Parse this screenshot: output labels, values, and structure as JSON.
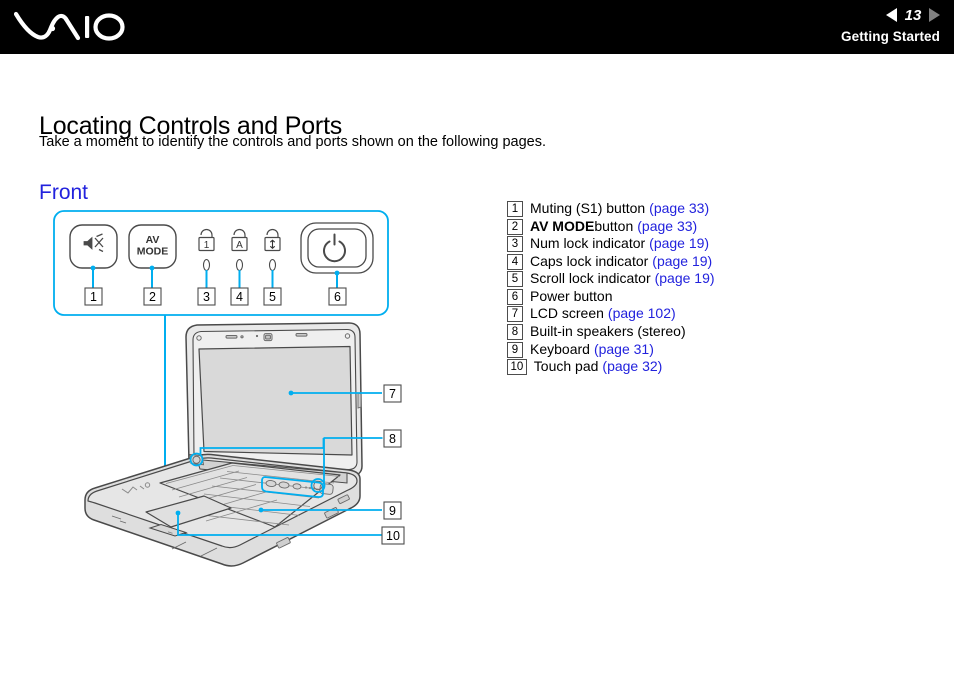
{
  "header": {
    "logo_text": "VAIO",
    "logo_icon": "vaio-logo",
    "prev_icon": "triangle-left-icon",
    "next_icon": "triangle-right-icon",
    "page_number": "13",
    "section": "Getting Started"
  },
  "content": {
    "title": "Locating Controls and Ports",
    "intro": "Take a moment to identify the controls and ports shown on the following pages.",
    "subsection": "Front"
  },
  "legend": {
    "items": [
      {
        "num": "1",
        "label": "Muting (S1) button",
        "bold": false,
        "ref": "(page 33)"
      },
      {
        "num": "2",
        "label": "AV MODE",
        "bold": true,
        "label_after": " button",
        "ref": "(page 33)"
      },
      {
        "num": "3",
        "label": "Num lock indicator",
        "bold": false,
        "ref": "(page 19)"
      },
      {
        "num": "4",
        "label": "Caps lock indicator",
        "bold": false,
        "ref": "(page 19)"
      },
      {
        "num": "5",
        "label": "Scroll lock indicator",
        "bold": false,
        "ref": "(page 19)"
      },
      {
        "num": "6",
        "label": "Power button",
        "bold": false,
        "ref": ""
      },
      {
        "num": "7",
        "label": "LCD screen",
        "bold": false,
        "ref": "(page 102)"
      },
      {
        "num": "8",
        "label": "Built-in speakers (stereo)",
        "bold": false,
        "ref": ""
      },
      {
        "num": "9",
        "label": "Keyboard",
        "bold": false,
        "ref": "(page 31)"
      },
      {
        "num": "10",
        "label": "Touch pad",
        "bold": false,
        "ref": "(page 32)"
      }
    ]
  },
  "diagram": {
    "panel_callouts": [
      "1",
      "2",
      "3",
      "4",
      "5",
      "6"
    ],
    "laptop_callouts": [
      "7",
      "8",
      "9",
      "10"
    ],
    "controls": [
      {
        "name": "mute-button",
        "icon": "speaker-mute-icon",
        "label": ""
      },
      {
        "name": "av-mode-button",
        "icon": "",
        "label_line1": "AV",
        "label_line2": "MODE"
      },
      {
        "name": "num-lock-indicator",
        "icon": "padlock-num-icon",
        "glyph": "1"
      },
      {
        "name": "caps-lock-indicator",
        "icon": "padlock-caps-icon",
        "glyph": "A"
      },
      {
        "name": "scroll-lock-indicator",
        "icon": "padlock-scroll-icon",
        "glyph": "↕"
      },
      {
        "name": "power-button",
        "icon": "power-symbol-icon",
        "label": ""
      }
    ]
  },
  "colors": {
    "link": "#2222dd",
    "accent_cyan": "#00aeef",
    "header_bg": "#000000",
    "lineart": "#4a4a4a"
  }
}
